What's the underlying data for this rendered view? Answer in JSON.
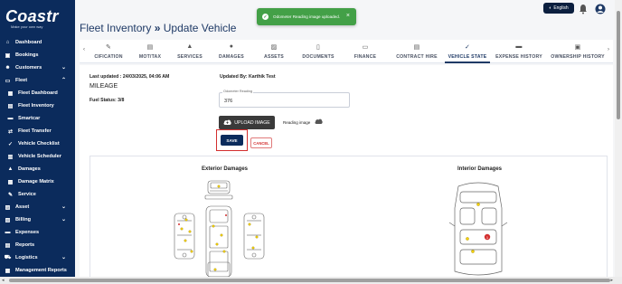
{
  "brand": {
    "logo_text": "Coastr",
    "tagline": "Make your own way"
  },
  "sidebar": {
    "items": [
      {
        "label": "Dashboard",
        "icon": "home-icon"
      },
      {
        "label": "Bookings",
        "icon": "calendar-icon"
      },
      {
        "label": "Customers",
        "icon": "people-icon",
        "chevron": "⌄"
      },
      {
        "label": "Fleet",
        "icon": "car-icon",
        "chevron": "⌃"
      },
      {
        "label": "Fleet Dashboard",
        "icon": "grid-icon"
      },
      {
        "label": "Fleet Inventory",
        "icon": "inventory-icon"
      },
      {
        "label": "Smartcar",
        "icon": "car-chip-icon"
      },
      {
        "label": "Fleet Transfer",
        "icon": "transfer-icon"
      },
      {
        "label": "Vehicle Checklist",
        "icon": "check-icon"
      },
      {
        "label": "Vehicle Scheduler",
        "icon": "scheduler-icon"
      },
      {
        "label": "Damages",
        "icon": "warning-icon"
      },
      {
        "label": "Damage Matrix",
        "icon": "matrix-icon"
      },
      {
        "label": "Service",
        "icon": "wrench-icon"
      },
      {
        "label": "Asset",
        "icon": "asset-icon",
        "chevron": "⌄"
      },
      {
        "label": "Billing",
        "icon": "billing-icon",
        "chevron": "⌄"
      },
      {
        "label": "Expenses",
        "icon": "expenses-icon"
      },
      {
        "label": "Reports",
        "icon": "reports-icon"
      },
      {
        "label": "Logistics",
        "icon": "logistics-icon",
        "chevron": "⌄"
      },
      {
        "label": "Management Reports",
        "icon": "report-icon"
      }
    ]
  },
  "topbar": {
    "language": "English"
  },
  "toast": {
    "message": "Odometer Reading image uploaded.",
    "close": "×"
  },
  "page": {
    "title": "Fleet Inventory",
    "separator": "»",
    "subtitle": "Update Vehicle"
  },
  "tabs": [
    {
      "label": "CIFICATION",
      "icon": "wrench-icon"
    },
    {
      "label": "MOT/TAX",
      "icon": "tax-icon"
    },
    {
      "label": "SERVICES",
      "icon": "warning-icon"
    },
    {
      "label": "DAMAGES",
      "icon": "damage-icon"
    },
    {
      "label": "ASSETS",
      "icon": "asset-icon"
    },
    {
      "label": "DOCUMENTS",
      "icon": "document-icon"
    },
    {
      "label": "FINANCE",
      "icon": "finance-icon"
    },
    {
      "label": "CONTRACT HIRE",
      "icon": "contract-icon"
    },
    {
      "label": "VEHICLE STATE",
      "icon": "state-icon",
      "active": true
    },
    {
      "label": "EXPENSE HISTORY",
      "icon": "expense-icon"
    },
    {
      "label": "OWNERSHIP HISTORY",
      "icon": "owner-icon"
    }
  ],
  "form": {
    "last_updated": "Last updated : 24/03/2025, 04:06 AM",
    "updated_by": "Updated By: Karthik Test",
    "section": "MILEAGE",
    "fuel_status": "Fuel Status: 3/8",
    "odometer_label": "Odometer Reading",
    "odometer_value": "376",
    "upload_label": "UPLOAD IMAGE",
    "reading_image_label": "Reading image",
    "save_label": "SAVE",
    "cancel_label": "CANCEL"
  },
  "damages": {
    "exterior_title": "Exterior Damages",
    "interior_title": "Interior Damages",
    "interior_marker": "1"
  },
  "colors": {
    "primary": "#0b2b5c",
    "toast": "#43a047",
    "danger": "#d32f2f",
    "marker": "#f5d000"
  }
}
